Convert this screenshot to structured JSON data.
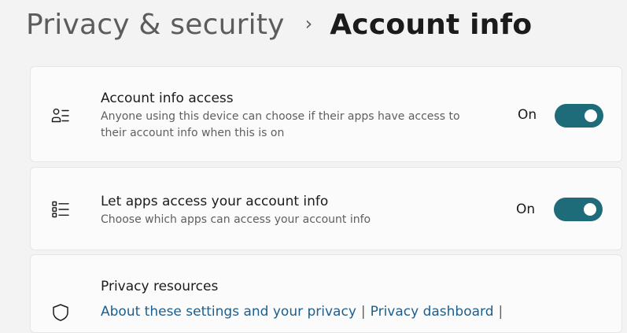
{
  "breadcrumb": {
    "parent": "Privacy & security",
    "separator": "›",
    "current": "Account info"
  },
  "settings": [
    {
      "icon": "account-info-icon",
      "title": "Account info access",
      "description": "Anyone using this device can choose if their apps have access to their account info when this is on",
      "state_label": "On",
      "toggle_on": true
    },
    {
      "icon": "app-list-icon",
      "title": "Let apps access your account info",
      "description": "Choose which apps can access your account info",
      "state_label": "On",
      "toggle_on": true
    }
  ],
  "privacy_resources": {
    "icon": "shield-icon",
    "title": "Privacy resources",
    "links": [
      "About these settings and your privacy",
      "Privacy dashboard"
    ],
    "separator": "|"
  },
  "colors": {
    "toggle_on": "#1e6b7a",
    "link": "#1d5e8c",
    "background": "#f3f3f3",
    "card": "#fbfbfb"
  }
}
